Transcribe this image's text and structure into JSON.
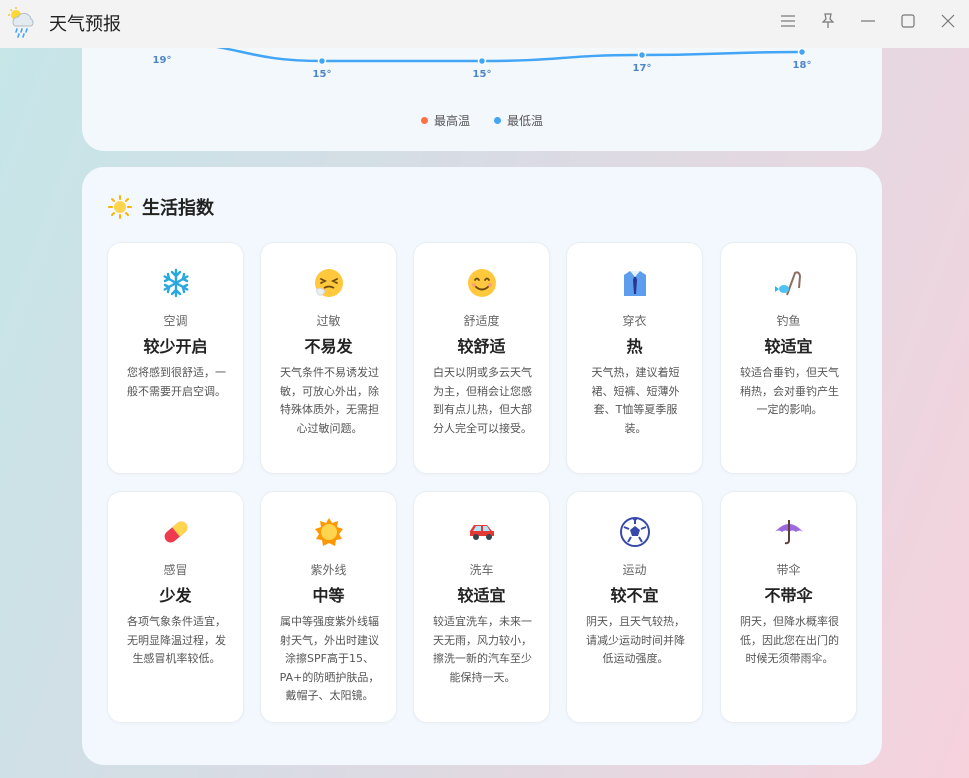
{
  "window": {
    "title": "天气预报",
    "app_icon": "cloud-sun-rain-icon"
  },
  "window_controls": [
    "menu-icon",
    "pin-icon",
    "minimize-icon",
    "maximize-icon",
    "close-icon"
  ],
  "forecast_chart": {
    "low_labels": [
      "19°",
      "15°",
      "15°",
      "17°",
      "18°"
    ],
    "legend": {
      "high": "最高温",
      "low": "最低温"
    },
    "colors": {
      "high": "#ff7043",
      "low": "#42a5f5"
    }
  },
  "chart_data": {
    "type": "line",
    "x": [
      1,
      2,
      3,
      4,
      5
    ],
    "series": [
      {
        "name": "最低温",
        "values": [
          19,
          15,
          15,
          17,
          18
        ]
      }
    ]
  },
  "life_index": {
    "title": "生活指数",
    "icon": "sun-icon",
    "cards": [
      {
        "icon": "snowflake-icon",
        "name": "空调",
        "level": "较少开启",
        "desc": "您将感到很舒适，一般不需要开启空调。"
      },
      {
        "icon": "sneezing-face-icon",
        "name": "过敏",
        "level": "不易发",
        "desc": "天气条件不易诱发过敏，可放心外出，除特殊体质外，无需担心过敏问题。"
      },
      {
        "icon": "smiling-face-icon",
        "name": "舒适度",
        "level": "较舒适",
        "desc": "白天以阴或多云天气为主，但稍会让您感到有点儿热，但大部分人完全可以接受。"
      },
      {
        "icon": "shirt-tie-icon",
        "name": "穿衣",
        "level": "热",
        "desc": "天气热，建议着短裙、短裤、短薄外套、T恤等夏季服装。"
      },
      {
        "icon": "fishing-rod-icon",
        "name": "钓鱼",
        "level": "较适宜",
        "desc": "较适合垂钓，但天气稍热，会对垂钓产生一定的影响。"
      },
      {
        "icon": "pill-icon",
        "name": "感冒",
        "level": "少发",
        "desc": "各项气象条件适宜，无明显降温过程，发生感冒机率较低。"
      },
      {
        "icon": "sun-uv-icon",
        "name": "紫外线",
        "level": "中等",
        "desc": "属中等强度紫外线辐射天气，外出时建议涂擦SPF高于15、PA+的防晒护肤品，戴帽子、太阳镜。"
      },
      {
        "icon": "car-icon",
        "name": "洗车",
        "level": "较适宜",
        "desc": "较适宜洗车，未来一天无雨，风力较小，擦洗一新的汽车至少能保持一天。"
      },
      {
        "icon": "soccer-ball-icon",
        "name": "运动",
        "level": "较不宜",
        "desc": "阴天，且天气较热，请减少运动时间并降低运动强度。"
      },
      {
        "icon": "umbrella-icon",
        "name": "带伞",
        "level": "不带伞",
        "desc": "阴天，但降水概率很低，因此您在出门的时候无须带雨伞。"
      }
    ]
  }
}
